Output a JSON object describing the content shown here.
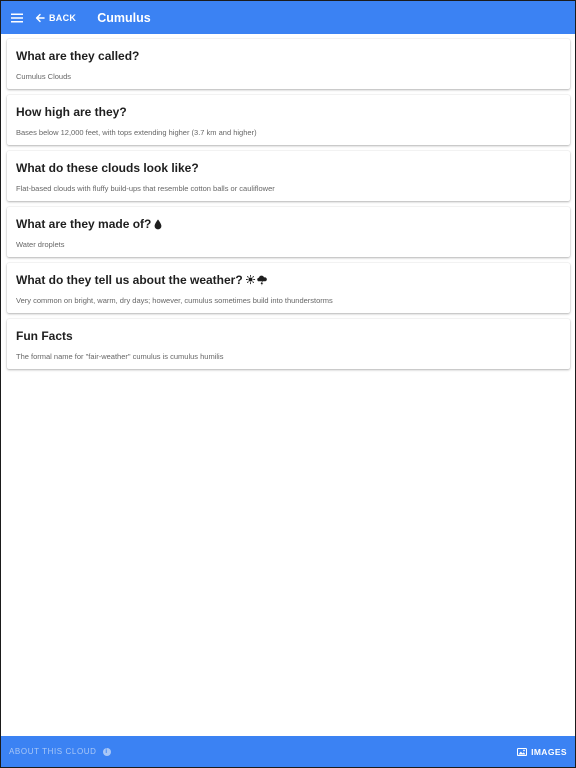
{
  "appbar": {
    "menu_icon": "menu-icon",
    "back_icon": "arrow-left-icon",
    "back_label": "BACK",
    "title": "Cumulus",
    "color": "#3b82f3"
  },
  "cards": [
    {
      "title": "What are they called?",
      "body": "Cumulus Clouds"
    },
    {
      "title": "How high are they?",
      "body": "Bases below 12,000 feet, with tops extending higher (3.7 km and higher)"
    },
    {
      "title": "What do these clouds look like?",
      "body": "Flat-based clouds with fluffy build-ups that resemble cotton balls or cauliflower"
    },
    {
      "title": "What are they made of?",
      "body": "Water droplets",
      "icon": "water-drop-icon"
    },
    {
      "title": "What do they tell us about the weather?",
      "body": "Very common on bright, warm, dry days; however, cumulus sometimes build into thunderstorms",
      "icon": "sun-and-storm-cloud-icon"
    },
    {
      "title": "Fun Facts",
      "body": "The formal name for \"fair-weather\" cumulus is cumulus humilis"
    }
  ],
  "bottombar": {
    "about_label": "ABOUT THIS CLOUD",
    "about_icon": "info-icon",
    "images_label": "IMAGES",
    "images_icon": "image-icon"
  }
}
